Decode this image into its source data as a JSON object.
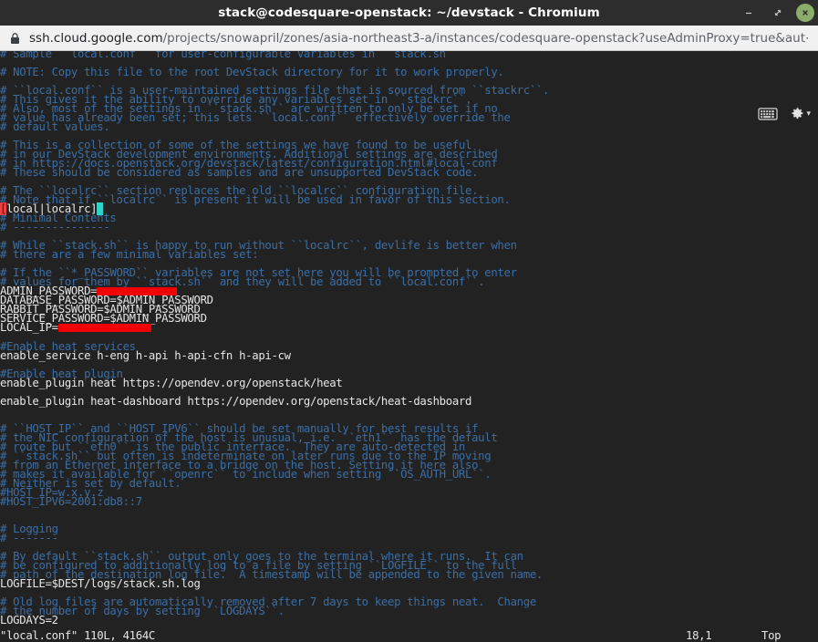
{
  "window": {
    "title": "stack@codesquare-openstack: ~/devstack - Chromium",
    "minimize_label": "–",
    "maximize_label": "⤡",
    "close_label": "✕"
  },
  "urlbar": {
    "lock_icon": "lock-icon",
    "host": "ssh.cloud.google.com",
    "path": "/projects/snowapril/zones/asia-northeast3-a/instances/codesquare-openstack?useAdminProxy=true&aut⋯"
  },
  "terminal_toolbar": {
    "keyboard_icon": "keyboard-icon",
    "settings_icon": "gear-icon",
    "settings_caret": "▾"
  },
  "editor": {
    "lines": [
      {
        "type": "comment",
        "text": "# Sample ``local.conf`` for user-configurable variables in ``stack.sh``"
      },
      {
        "type": "blank",
        "text": ""
      },
      {
        "type": "comment",
        "text": "# NOTE: Copy this file to the root DevStack directory for it to work properly."
      },
      {
        "type": "blank",
        "text": ""
      },
      {
        "type": "comment",
        "text": "# ``local.conf`` is a user-maintained settings file that is sourced from ``stackrc``."
      },
      {
        "type": "comment",
        "text": "# This gives it the ability to override any variables set in ``stackrc``."
      },
      {
        "type": "comment",
        "text": "# Also, most of the settings in ``stack.sh`` are written to only be set if no"
      },
      {
        "type": "comment",
        "text": "# value has already been set; this lets ``local.conf`` effectively override the"
      },
      {
        "type": "comment",
        "text": "# default values."
      },
      {
        "type": "blank",
        "text": ""
      },
      {
        "type": "comment",
        "text": "# This is a collection of some of the settings we have found to be useful"
      },
      {
        "type": "comment",
        "text": "# in our DevStack development environments. Additional settings are described"
      },
      {
        "type": "comment",
        "text": "# in https://docs.openstack.org/devstack/latest/configuration.html#local-conf"
      },
      {
        "type": "comment",
        "text": "# These should be considered as samples and are unsupported DevStack code."
      },
      {
        "type": "blank",
        "text": ""
      },
      {
        "type": "comment",
        "text": "# The ``localrc`` section replaces the old ``localrc`` configuration file."
      },
      {
        "type": "comment",
        "text": "# Note that if ``localrc`` is present it will be used in favor of this section."
      },
      {
        "type": "section",
        "text": "[local|localrc]",
        "bracket": "[",
        "cursor": " "
      },
      {
        "type": "comment",
        "text": "# Minimal Contents"
      },
      {
        "type": "comment",
        "text": "# ---------------"
      },
      {
        "type": "blank",
        "text": ""
      },
      {
        "type": "comment",
        "text": "# While ``stack.sh`` is happy to run without ``localrc``, devlife is better when"
      },
      {
        "type": "comment",
        "text": "# there are a few minimal variables set:"
      },
      {
        "type": "blank",
        "text": ""
      },
      {
        "type": "comment",
        "text": "# If the ``*_PASSWORD`` variables are not set here you will be prompted to enter"
      },
      {
        "type": "comment",
        "text": "# values for them by ``stack.sh`` and they will be added to ``local.conf``."
      },
      {
        "type": "redacted",
        "prefix": "ADMIN_PASSWORD=",
        "redact_chars": 12
      },
      {
        "type": "plain",
        "text": "DATABASE_PASSWORD=$ADMIN_PASSWORD"
      },
      {
        "type": "plain",
        "text": "RABBIT_PASSWORD=$ADMIN_PASSWORD"
      },
      {
        "type": "plain",
        "text": "SERVICE_PASSWORD=$ADMIN_PASSWORD"
      },
      {
        "type": "redacted",
        "prefix": "LOCAL_IP=",
        "redact_chars": 14
      },
      {
        "type": "blank",
        "text": ""
      },
      {
        "type": "comment",
        "text": "#Enable heat services"
      },
      {
        "type": "plain",
        "text": "enable_service h-eng h-api h-api-cfn h-api-cw"
      },
      {
        "type": "blank",
        "text": ""
      },
      {
        "type": "comment",
        "text": "#Enable heat plugin"
      },
      {
        "type": "plain",
        "text": "enable_plugin heat https://opendev.org/openstack/heat"
      },
      {
        "type": "blank",
        "text": ""
      },
      {
        "type": "plain",
        "text": "enable_plugin heat-dashboard https://opendev.org/openstack/heat-dashboard"
      },
      {
        "type": "blank",
        "text": ""
      },
      {
        "type": "blank",
        "text": ""
      },
      {
        "type": "comment",
        "text": "# ``HOST_IP`` and ``HOST_IPV6`` should be set manually for best results if"
      },
      {
        "type": "comment",
        "text": "# the NIC configuration of the host is unusual, i.e. ``eth1`` has the default"
      },
      {
        "type": "comment",
        "text": "# route but ``eth0`` is the public interface.  They are auto-detected in"
      },
      {
        "type": "comment",
        "text": "# ``stack.sh`` but often is indeterminate on later runs due to the IP moving"
      },
      {
        "type": "comment",
        "text": "# from an Ethernet interface to a bridge on the host. Setting it here also"
      },
      {
        "type": "comment",
        "text": "# makes it available for ``openrc`` to include when setting ``OS_AUTH_URL``."
      },
      {
        "type": "comment",
        "text": "# Neither is set by default."
      },
      {
        "type": "comment",
        "text": "#HOST_IP=w.x.y.z"
      },
      {
        "type": "comment",
        "text": "#HOST_IPV6=2001:db8::7"
      },
      {
        "type": "blank",
        "text": ""
      },
      {
        "type": "blank",
        "text": ""
      },
      {
        "type": "comment",
        "text": "# Logging"
      },
      {
        "type": "comment",
        "text": "# -------"
      },
      {
        "type": "blank",
        "text": ""
      },
      {
        "type": "comment",
        "text": "# By default ``stack.sh`` output only goes to the terminal where it runs.  It can"
      },
      {
        "type": "comment",
        "text": "# be configured to additionally log to a file by setting ``LOGFILE`` to the full"
      },
      {
        "type": "comment",
        "text": "# path of the destination log file.  A timestamp will be appended to the given name."
      },
      {
        "type": "plain",
        "text": "LOGFILE=$DEST/logs/stack.sh.log"
      },
      {
        "type": "blank",
        "text": ""
      },
      {
        "type": "comment",
        "text": "# Old log files are automatically removed after 7 days to keep things neat.  Change"
      },
      {
        "type": "comment",
        "text": "# the number of days by setting ``LOGDAYS``."
      },
      {
        "type": "plain",
        "text": "LOGDAYS=2"
      }
    ]
  },
  "statusline": {
    "file": "\"local.conf\" 110L, 4164C",
    "position": "18,1",
    "location": "Top"
  },
  "colors": {
    "terminal_bg": "#222222",
    "comment": "#3b6ea5",
    "plain_text": "#e6e6e6",
    "redaction": "#f00000",
    "cursor": "#2fd4c8",
    "highlight_red": "#f04040",
    "titlebar_bg": "#2d2d2d",
    "urlbar_bg": "#f1f1f1",
    "close_button": "#8aad6a"
  }
}
